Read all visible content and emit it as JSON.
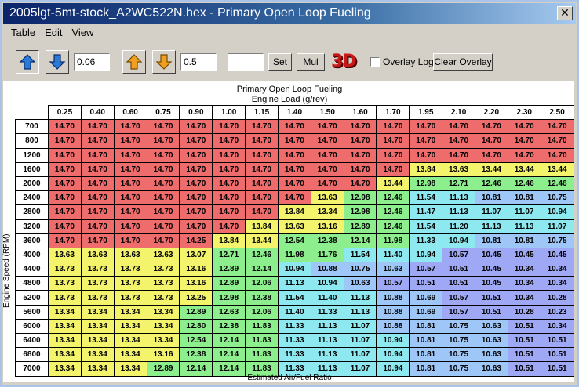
{
  "window": {
    "title": "2005lgt-5mt-stock_A2WC522N.hex - Primary Open Loop Fueling",
    "close_glyph": "✕"
  },
  "menu": [
    "Table",
    "Edit",
    "View"
  ],
  "toolbar": {
    "step_large_value": "0.06",
    "step_small_value": "0.5",
    "set_value": "",
    "set_label": "Set",
    "mul_label": "Mul",
    "logo_3d": "3D",
    "overlay_log_label": "Overlay Log",
    "clear_overlay_label": "Clear Overlay",
    "icons": [
      "arrow-up-blue-icon",
      "arrow-down-blue-icon",
      "arrow-up-orange-icon",
      "arrow-down-orange-icon"
    ]
  },
  "table": {
    "title": "Primary Open Loop Fueling",
    "x_axis_label": "Engine Load (g/rev)",
    "y_axis_label": "Engine Speed (RPM)",
    "footer_label": "Estimated Air/Fuel Ratio",
    "columns": [
      "0.25",
      "0.40",
      "0.60",
      "0.75",
      "0.90",
      "1.00",
      "1.15",
      "1.40",
      "1.50",
      "1.60",
      "1.70",
      "1.95",
      "2.10",
      "2.20",
      "2.30",
      "2.50"
    ],
    "rows": [
      "700",
      "800",
      "1200",
      "1600",
      "2000",
      "2400",
      "2800",
      "3200",
      "3600",
      "4000",
      "4400",
      "4800",
      "5200",
      "5600",
      "6000",
      "6400",
      "6800",
      "7000"
    ],
    "values": [
      [
        "14.70",
        "14.70",
        "14.70",
        "14.70",
        "14.70",
        "14.70",
        "14.70",
        "14.70",
        "14.70",
        "14.70",
        "14.70",
        "14.70",
        "14.70",
        "14.70",
        "14.70",
        "14.70"
      ],
      [
        "14.70",
        "14.70",
        "14.70",
        "14.70",
        "14.70",
        "14.70",
        "14.70",
        "14.70",
        "14.70",
        "14.70",
        "14.70",
        "14.70",
        "14.70",
        "14.70",
        "14.70",
        "14.70"
      ],
      [
        "14.70",
        "14.70",
        "14.70",
        "14.70",
        "14.70",
        "14.70",
        "14.70",
        "14.70",
        "14.70",
        "14.70",
        "14.70",
        "14.70",
        "14.70",
        "14.70",
        "14.70",
        "14.70"
      ],
      [
        "14.70",
        "14.70",
        "14.70",
        "14.70",
        "14.70",
        "14.70",
        "14.70",
        "14.70",
        "14.70",
        "14.70",
        "14.70",
        "13.84",
        "13.63",
        "13.44",
        "13.44",
        "13.44"
      ],
      [
        "14.70",
        "14.70",
        "14.70",
        "14.70",
        "14.70",
        "14.70",
        "14.70",
        "14.70",
        "14.70",
        "14.70",
        "13.44",
        "12.98",
        "12.71",
        "12.46",
        "12.46",
        "12.46"
      ],
      [
        "14.70",
        "14.70",
        "14.70",
        "14.70",
        "14.70",
        "14.70",
        "14.70",
        "14.70",
        "13.63",
        "12.98",
        "12.46",
        "11.54",
        "11.13",
        "10.81",
        "10.81",
        "10.75"
      ],
      [
        "14.70",
        "14.70",
        "14.70",
        "14.70",
        "14.70",
        "14.70",
        "14.70",
        "13.84",
        "13.34",
        "12.98",
        "12.46",
        "11.47",
        "11.13",
        "11.07",
        "11.07",
        "10.94"
      ],
      [
        "14.70",
        "14.70",
        "14.70",
        "14.70",
        "14.70",
        "14.70",
        "13.84",
        "13.63",
        "13.16",
        "12.89",
        "12.46",
        "11.54",
        "11.20",
        "11.13",
        "11.13",
        "11.07"
      ],
      [
        "14.70",
        "14.70",
        "14.70",
        "14.70",
        "14.25",
        "13.84",
        "13.44",
        "12.54",
        "12.38",
        "12.14",
        "11.98",
        "11.33",
        "10.94",
        "10.81",
        "10.81",
        "10.75"
      ],
      [
        "13.63",
        "13.63",
        "13.63",
        "13.63",
        "13.07",
        "12.71",
        "12.46",
        "11.98",
        "11.76",
        "11.54",
        "11.40",
        "10.94",
        "10.57",
        "10.45",
        "10.45",
        "10.45"
      ],
      [
        "13.73",
        "13.73",
        "13.73",
        "13.73",
        "13.16",
        "12.89",
        "12.14",
        "10.94",
        "10.88",
        "10.75",
        "10.63",
        "10.57",
        "10.51",
        "10.45",
        "10.34",
        "10.34"
      ],
      [
        "13.73",
        "13.73",
        "13.73",
        "13.73",
        "13.16",
        "12.89",
        "12.06",
        "11.13",
        "10.94",
        "10.63",
        "10.57",
        "10.51",
        "10.51",
        "10.45",
        "10.34",
        "10.34"
      ],
      [
        "13.73",
        "13.73",
        "13.73",
        "13.73",
        "13.25",
        "12.98",
        "12.38",
        "11.54",
        "11.40",
        "11.13",
        "10.88",
        "10.69",
        "10.57",
        "10.51",
        "10.34",
        "10.28"
      ],
      [
        "13.34",
        "13.34",
        "13.34",
        "13.34",
        "12.89",
        "12.63",
        "12.06",
        "11.40",
        "11.33",
        "11.13",
        "10.88",
        "10.69",
        "10.57",
        "10.51",
        "10.28",
        "10.23"
      ],
      [
        "13.34",
        "13.34",
        "13.34",
        "13.34",
        "12.80",
        "12.38",
        "11.83",
        "11.33",
        "11.13",
        "11.07",
        "10.88",
        "10.81",
        "10.75",
        "10.63",
        "10.51",
        "10.34"
      ],
      [
        "13.34",
        "13.34",
        "13.34",
        "13.34",
        "12.54",
        "12.14",
        "11.83",
        "11.33",
        "11.13",
        "11.07",
        "10.94",
        "10.81",
        "10.75",
        "10.63",
        "10.51",
        "10.51"
      ],
      [
        "13.34",
        "13.34",
        "13.34",
        "13.16",
        "12.38",
        "12.14",
        "11.83",
        "11.33",
        "11.13",
        "11.07",
        "10.94",
        "10.81",
        "10.75",
        "10.63",
        "10.51",
        "10.51"
      ],
      [
        "13.34",
        "13.34",
        "13.34",
        "12.89",
        "12.14",
        "12.14",
        "11.83",
        "11.33",
        "11.13",
        "11.07",
        "10.94",
        "10.81",
        "10.75",
        "10.63",
        "10.51",
        "10.51"
      ]
    ]
  }
}
